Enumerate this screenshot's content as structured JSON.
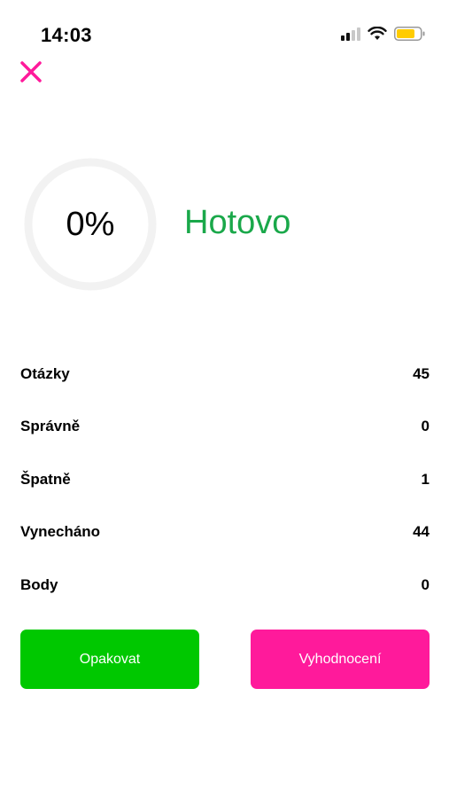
{
  "status_bar": {
    "time": "14:03"
  },
  "colors": {
    "accent_pink": "#ff1a9b",
    "success_green": "#00c800",
    "title_green": "#1aa84a",
    "ring_gray": "#f2f2f2",
    "battery_yellow": "#ffcc00"
  },
  "result": {
    "percent": "0%",
    "status": "Hotovo"
  },
  "stats": [
    {
      "label": "Otázky",
      "value": "45"
    },
    {
      "label": "Správně",
      "value": "0"
    },
    {
      "label": "Špatně",
      "value": "1"
    },
    {
      "label": "Vynecháno",
      "value": "44"
    },
    {
      "label": "Body",
      "value": "0"
    }
  ],
  "buttons": {
    "repeat_label": "Opakovat",
    "evaluation_label": "Vyhodnocení"
  }
}
